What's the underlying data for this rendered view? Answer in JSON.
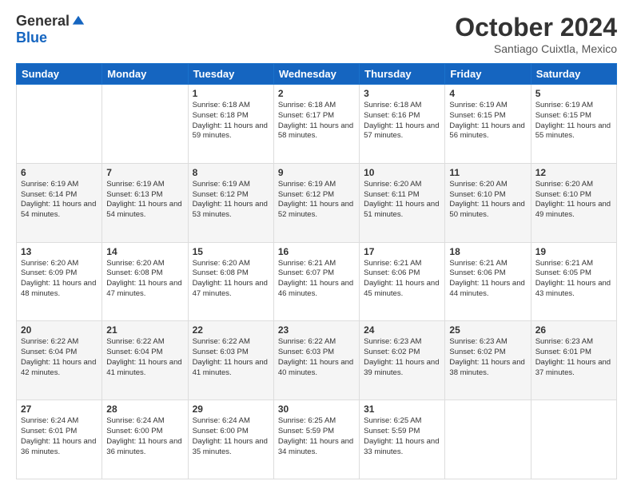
{
  "header": {
    "logo_general": "General",
    "logo_blue": "Blue",
    "month_title": "October 2024",
    "subtitle": "Santiago Cuixtla, Mexico"
  },
  "days": [
    "Sunday",
    "Monday",
    "Tuesday",
    "Wednesday",
    "Thursday",
    "Friday",
    "Saturday"
  ],
  "weeks": [
    [
      {
        "day": "",
        "sunrise": "",
        "sunset": "",
        "daylight": ""
      },
      {
        "day": "",
        "sunrise": "",
        "sunset": "",
        "daylight": ""
      },
      {
        "day": "1",
        "sunrise": "Sunrise: 6:18 AM",
        "sunset": "Sunset: 6:18 PM",
        "daylight": "Daylight: 11 hours and 59 minutes."
      },
      {
        "day": "2",
        "sunrise": "Sunrise: 6:18 AM",
        "sunset": "Sunset: 6:17 PM",
        "daylight": "Daylight: 11 hours and 58 minutes."
      },
      {
        "day": "3",
        "sunrise": "Sunrise: 6:18 AM",
        "sunset": "Sunset: 6:16 PM",
        "daylight": "Daylight: 11 hours and 57 minutes."
      },
      {
        "day": "4",
        "sunrise": "Sunrise: 6:19 AM",
        "sunset": "Sunset: 6:15 PM",
        "daylight": "Daylight: 11 hours and 56 minutes."
      },
      {
        "day": "5",
        "sunrise": "Sunrise: 6:19 AM",
        "sunset": "Sunset: 6:15 PM",
        "daylight": "Daylight: 11 hours and 55 minutes."
      }
    ],
    [
      {
        "day": "6",
        "sunrise": "Sunrise: 6:19 AM",
        "sunset": "Sunset: 6:14 PM",
        "daylight": "Daylight: 11 hours and 54 minutes."
      },
      {
        "day": "7",
        "sunrise": "Sunrise: 6:19 AM",
        "sunset": "Sunset: 6:13 PM",
        "daylight": "Daylight: 11 hours and 54 minutes."
      },
      {
        "day": "8",
        "sunrise": "Sunrise: 6:19 AM",
        "sunset": "Sunset: 6:12 PM",
        "daylight": "Daylight: 11 hours and 53 minutes."
      },
      {
        "day": "9",
        "sunrise": "Sunrise: 6:19 AM",
        "sunset": "Sunset: 6:12 PM",
        "daylight": "Daylight: 11 hours and 52 minutes."
      },
      {
        "day": "10",
        "sunrise": "Sunrise: 6:20 AM",
        "sunset": "Sunset: 6:11 PM",
        "daylight": "Daylight: 11 hours and 51 minutes."
      },
      {
        "day": "11",
        "sunrise": "Sunrise: 6:20 AM",
        "sunset": "Sunset: 6:10 PM",
        "daylight": "Daylight: 11 hours and 50 minutes."
      },
      {
        "day": "12",
        "sunrise": "Sunrise: 6:20 AM",
        "sunset": "Sunset: 6:10 PM",
        "daylight": "Daylight: 11 hours and 49 minutes."
      }
    ],
    [
      {
        "day": "13",
        "sunrise": "Sunrise: 6:20 AM",
        "sunset": "Sunset: 6:09 PM",
        "daylight": "Daylight: 11 hours and 48 minutes."
      },
      {
        "day": "14",
        "sunrise": "Sunrise: 6:20 AM",
        "sunset": "Sunset: 6:08 PM",
        "daylight": "Daylight: 11 hours and 47 minutes."
      },
      {
        "day": "15",
        "sunrise": "Sunrise: 6:20 AM",
        "sunset": "Sunset: 6:08 PM",
        "daylight": "Daylight: 11 hours and 47 minutes."
      },
      {
        "day": "16",
        "sunrise": "Sunrise: 6:21 AM",
        "sunset": "Sunset: 6:07 PM",
        "daylight": "Daylight: 11 hours and 46 minutes."
      },
      {
        "day": "17",
        "sunrise": "Sunrise: 6:21 AM",
        "sunset": "Sunset: 6:06 PM",
        "daylight": "Daylight: 11 hours and 45 minutes."
      },
      {
        "day": "18",
        "sunrise": "Sunrise: 6:21 AM",
        "sunset": "Sunset: 6:06 PM",
        "daylight": "Daylight: 11 hours and 44 minutes."
      },
      {
        "day": "19",
        "sunrise": "Sunrise: 6:21 AM",
        "sunset": "Sunset: 6:05 PM",
        "daylight": "Daylight: 11 hours and 43 minutes."
      }
    ],
    [
      {
        "day": "20",
        "sunrise": "Sunrise: 6:22 AM",
        "sunset": "Sunset: 6:04 PM",
        "daylight": "Daylight: 11 hours and 42 minutes."
      },
      {
        "day": "21",
        "sunrise": "Sunrise: 6:22 AM",
        "sunset": "Sunset: 6:04 PM",
        "daylight": "Daylight: 11 hours and 41 minutes."
      },
      {
        "day": "22",
        "sunrise": "Sunrise: 6:22 AM",
        "sunset": "Sunset: 6:03 PM",
        "daylight": "Daylight: 11 hours and 41 minutes."
      },
      {
        "day": "23",
        "sunrise": "Sunrise: 6:22 AM",
        "sunset": "Sunset: 6:03 PM",
        "daylight": "Daylight: 11 hours and 40 minutes."
      },
      {
        "day": "24",
        "sunrise": "Sunrise: 6:23 AM",
        "sunset": "Sunset: 6:02 PM",
        "daylight": "Daylight: 11 hours and 39 minutes."
      },
      {
        "day": "25",
        "sunrise": "Sunrise: 6:23 AM",
        "sunset": "Sunset: 6:02 PM",
        "daylight": "Daylight: 11 hours and 38 minutes."
      },
      {
        "day": "26",
        "sunrise": "Sunrise: 6:23 AM",
        "sunset": "Sunset: 6:01 PM",
        "daylight": "Daylight: 11 hours and 37 minutes."
      }
    ],
    [
      {
        "day": "27",
        "sunrise": "Sunrise: 6:24 AM",
        "sunset": "Sunset: 6:01 PM",
        "daylight": "Daylight: 11 hours and 36 minutes."
      },
      {
        "day": "28",
        "sunrise": "Sunrise: 6:24 AM",
        "sunset": "Sunset: 6:00 PM",
        "daylight": "Daylight: 11 hours and 36 minutes."
      },
      {
        "day": "29",
        "sunrise": "Sunrise: 6:24 AM",
        "sunset": "Sunset: 6:00 PM",
        "daylight": "Daylight: 11 hours and 35 minutes."
      },
      {
        "day": "30",
        "sunrise": "Sunrise: 6:25 AM",
        "sunset": "Sunset: 5:59 PM",
        "daylight": "Daylight: 11 hours and 34 minutes."
      },
      {
        "day": "31",
        "sunrise": "Sunrise: 6:25 AM",
        "sunset": "Sunset: 5:59 PM",
        "daylight": "Daylight: 11 hours and 33 minutes."
      },
      {
        "day": "",
        "sunrise": "",
        "sunset": "",
        "daylight": ""
      },
      {
        "day": "",
        "sunrise": "",
        "sunset": "",
        "daylight": ""
      }
    ]
  ]
}
